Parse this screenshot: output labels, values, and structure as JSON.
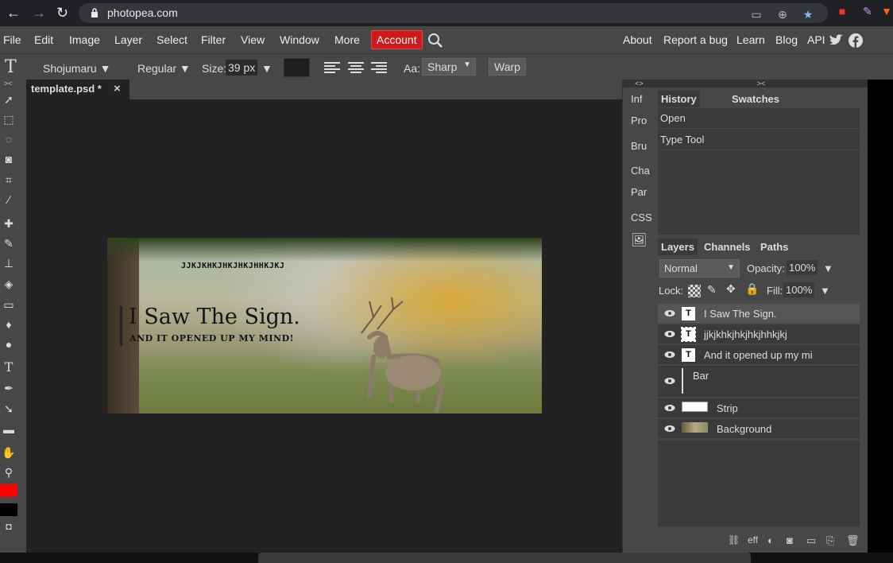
{
  "browser": {
    "url": "photopea.com",
    "icons": [
      "back-icon",
      "forward-icon",
      "reload-icon",
      "lock-icon",
      "cast-icon",
      "extensions-icon",
      "star-icon"
    ]
  },
  "menu": {
    "items": [
      "File",
      "Edit",
      "Image",
      "Layer",
      "Select",
      "Filter",
      "View",
      "Window",
      "More"
    ],
    "account": "Account",
    "right": [
      "About",
      "Report a bug",
      "Learn",
      "Blog",
      "API"
    ]
  },
  "options": {
    "tool_glyph": "T",
    "font": "Shojumaru",
    "style": "Regular",
    "size_label": "Size:",
    "size_value": "39 px",
    "aa_label": "Aa:",
    "aa_value": "Sharp",
    "warp": "Warp",
    "color": "#1e1e1e"
  },
  "tabs": {
    "doc_title": "template.psd *",
    "close": "×"
  },
  "canvas": {
    "small_text": "JJKJKHKJHKJHKJHHKJKJ",
    "headline": "I Saw The Sign.",
    "subline": "AND IT OPENED UP MY MIND!"
  },
  "mini_panel": [
    "Inf",
    "Pro",
    "Bru",
    "Cha",
    "Par",
    "CSS"
  ],
  "history": {
    "tabs": [
      "History",
      "Swatches"
    ],
    "rows": [
      "Open",
      "Type Tool"
    ]
  },
  "layers_panel": {
    "tabs": [
      "Layers",
      "Channels",
      "Paths"
    ],
    "blend_mode": "Normal",
    "opacity_label": "Opacity:",
    "opacity_value": "100%",
    "lock_label": "Lock:",
    "fill_label": "Fill:",
    "fill_value": "100%",
    "layers": [
      {
        "name": "I Saw The Sign.",
        "kind": "text"
      },
      {
        "name": "jjkjkhkjhkjhkjhhkjkj",
        "kind": "text"
      },
      {
        "name": "And it opened up my mi",
        "kind": "text"
      },
      {
        "name": "Bar",
        "kind": "shape"
      },
      {
        "name": "Strip",
        "kind": "raster"
      },
      {
        "name": "Background",
        "kind": "image"
      }
    ],
    "bottom": "eff"
  },
  "colors": {
    "foreground": "#ff0000",
    "background": "#000000",
    "accent": "#cf1a1a"
  }
}
